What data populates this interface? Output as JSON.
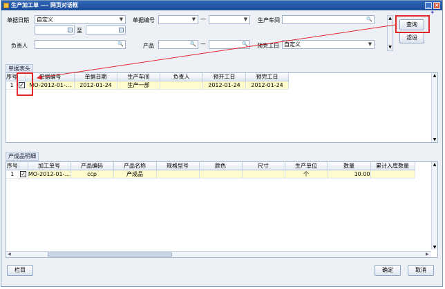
{
  "window": {
    "title": "生产加工单 —- 网页对话框"
  },
  "filters": {
    "doc_date_label": "单据日期",
    "doc_date_value": "自定义",
    "date_to_label": "至",
    "doc_no_label": "单据编号",
    "dash": "—",
    "workshop_label": "生产车间",
    "owner_label": "负责人",
    "product_label": "产品",
    "planned_finish_label": "预完工日",
    "planned_finish_value": "自定义"
  },
  "buttons": {
    "query": "查询",
    "filter": "滤设",
    "columns": "栏目",
    "ok": "确定",
    "cancel": "取消"
  },
  "header_section": {
    "title": "单据表头",
    "columns": [
      "序号",
      "",
      "单据编号",
      "单据日期",
      "生产车间",
      "负责人",
      "预开工日",
      "预完工日"
    ],
    "rows": [
      {
        "index": "1",
        "checked": "✓",
        "doc_no": "MO-2012-01-...",
        "doc_date": "2012-01-24",
        "workshop": "生产一部",
        "owner": "",
        "planned_start": "2012-01-24",
        "planned_finish": "2012-01-24"
      }
    ]
  },
  "detail_section": {
    "title": "产成品明细",
    "columns": [
      "序号",
      "",
      "加工单号",
      "产品编码",
      "产品名称",
      "规格型号",
      "颜色",
      "尺寸",
      "生产单位",
      "数量",
      "累计入库数量"
    ],
    "rows": [
      {
        "index": "1",
        "checked": "✓",
        "order_no": "MO-2012-01-...",
        "product_code": "ccp",
        "product_name": "产成品",
        "spec": "",
        "color": "",
        "size": "",
        "unit": "个",
        "qty": "10.00",
        "stocked_qty": ""
      }
    ]
  },
  "colors": {
    "highlight": "#e0262a",
    "row_selected": "#fffbcc",
    "titlebar": "#2f65b7"
  }
}
